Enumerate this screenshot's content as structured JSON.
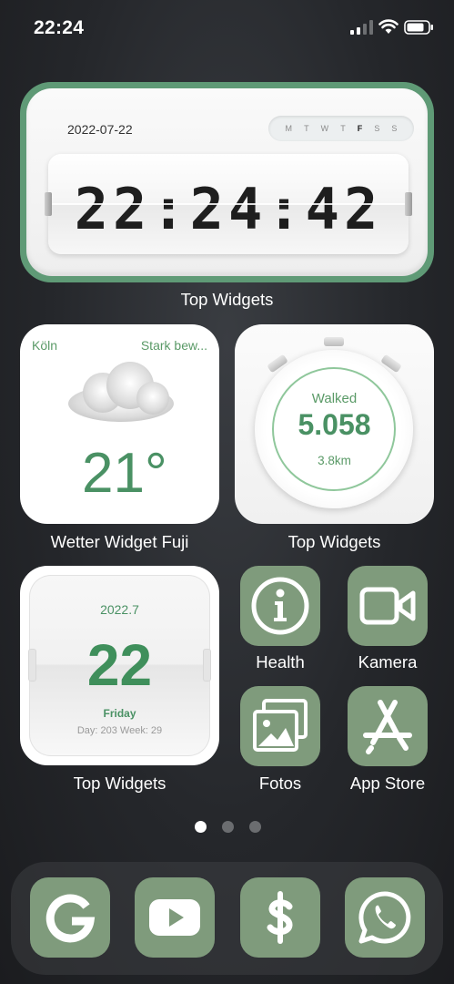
{
  "status_bar": {
    "time": "22:24"
  },
  "clock_widget": {
    "date": "2022-07-22",
    "weekdays": [
      "M",
      "T",
      "W",
      "T",
      "F",
      "S",
      "S"
    ],
    "active_weekday_index": 4,
    "time": "22:24:42",
    "label": "Top Widgets"
  },
  "weather_widget": {
    "city": "Köln",
    "condition": "Stark bew...",
    "temperature": "21°",
    "label": "Wetter Widget Fuji"
  },
  "walk_widget": {
    "title": "Walked",
    "steps": "5.058",
    "distance": "3.8km",
    "label": "Top Widgets"
  },
  "calendar_widget": {
    "month": "2022.7",
    "day": "22",
    "weekday": "Friday",
    "info": "Day: 203 Week: 29",
    "label": "Top Widgets"
  },
  "apps": [
    {
      "label": "Health",
      "icon": "info-icon"
    },
    {
      "label": "Kamera",
      "icon": "video-camera-icon"
    },
    {
      "label": "Fotos",
      "icon": "photos-icon"
    },
    {
      "label": "App Store",
      "icon": "app-store-icon"
    }
  ],
  "page_indicator": {
    "count": 3,
    "active": 0
  },
  "dock": [
    {
      "icon": "google-icon"
    },
    {
      "icon": "youtube-icon"
    },
    {
      "icon": "dollar-icon"
    },
    {
      "icon": "whatsapp-icon"
    }
  ],
  "colors": {
    "widget_green": "#4a9164",
    "app_icon_bg": "#7f9b7c",
    "clock_frame": "#5f9a76"
  }
}
